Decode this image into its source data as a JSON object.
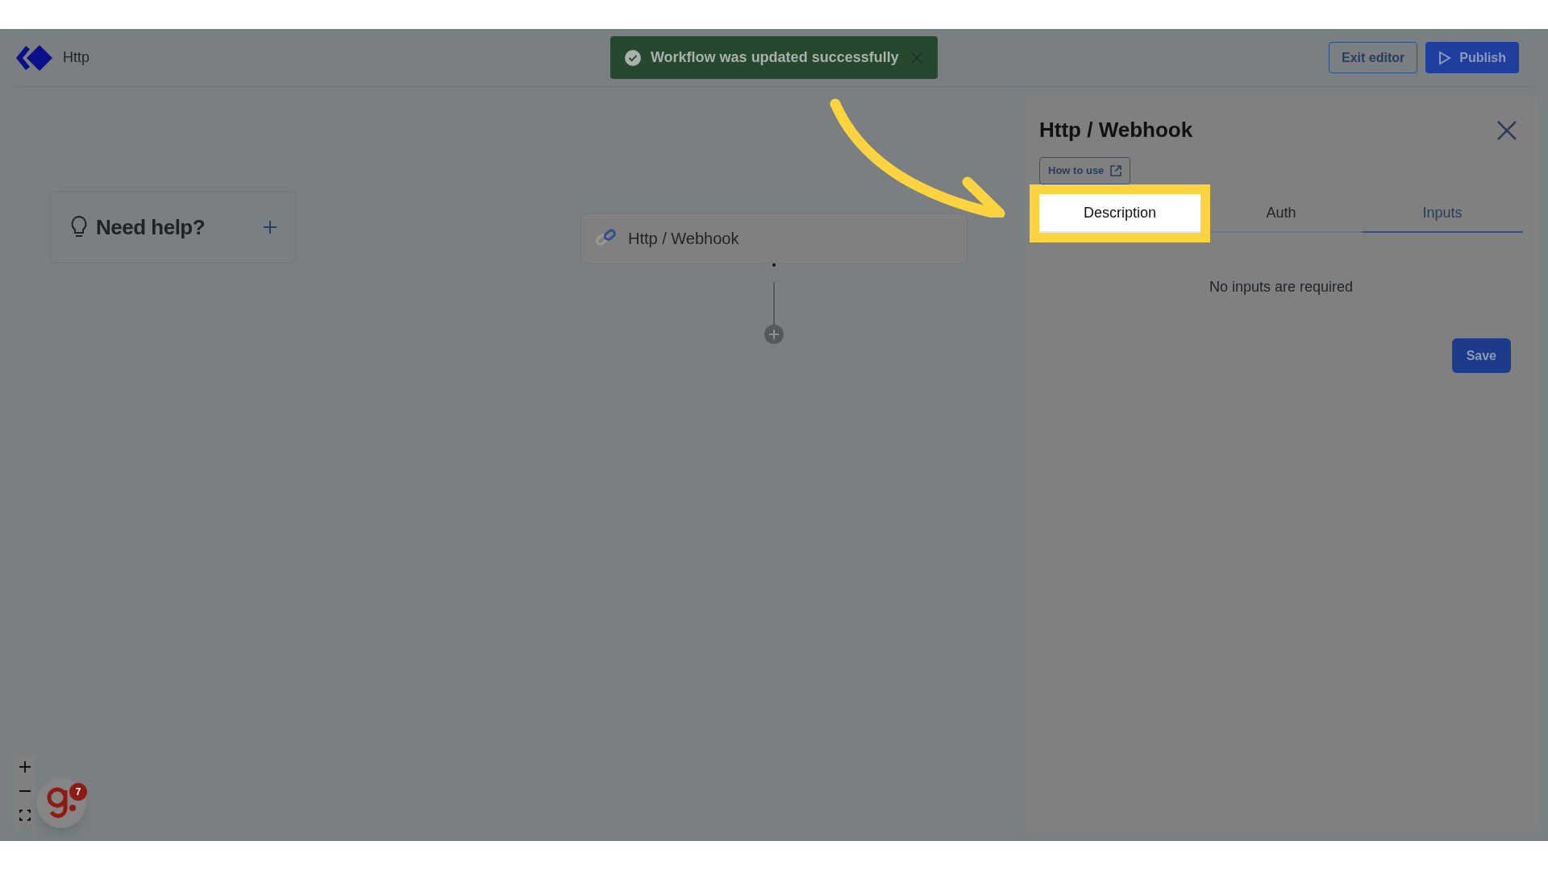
{
  "header": {
    "title": "Http",
    "buttons": [
      {
        "label": "Exit editor",
        "kind": "outline"
      },
      {
        "label": "Publish",
        "kind": "primary"
      }
    ]
  },
  "toast": {
    "text": "Workflow was updated successfully"
  },
  "help_card": {
    "title": "Need help?"
  },
  "node": {
    "title": "Http / Webhook"
  },
  "panel": {
    "title": "Http / Webhook",
    "how_to_use": "How to use",
    "tabs": [
      {
        "label": "Description",
        "selected": false,
        "highlighted": true
      },
      {
        "label": "Auth",
        "selected": false,
        "highlighted": false
      },
      {
        "label": "Inputs",
        "selected": true,
        "highlighted": false
      }
    ],
    "message": "No inputs are required",
    "save": "Save"
  },
  "assistant": {
    "badge": "7"
  }
}
